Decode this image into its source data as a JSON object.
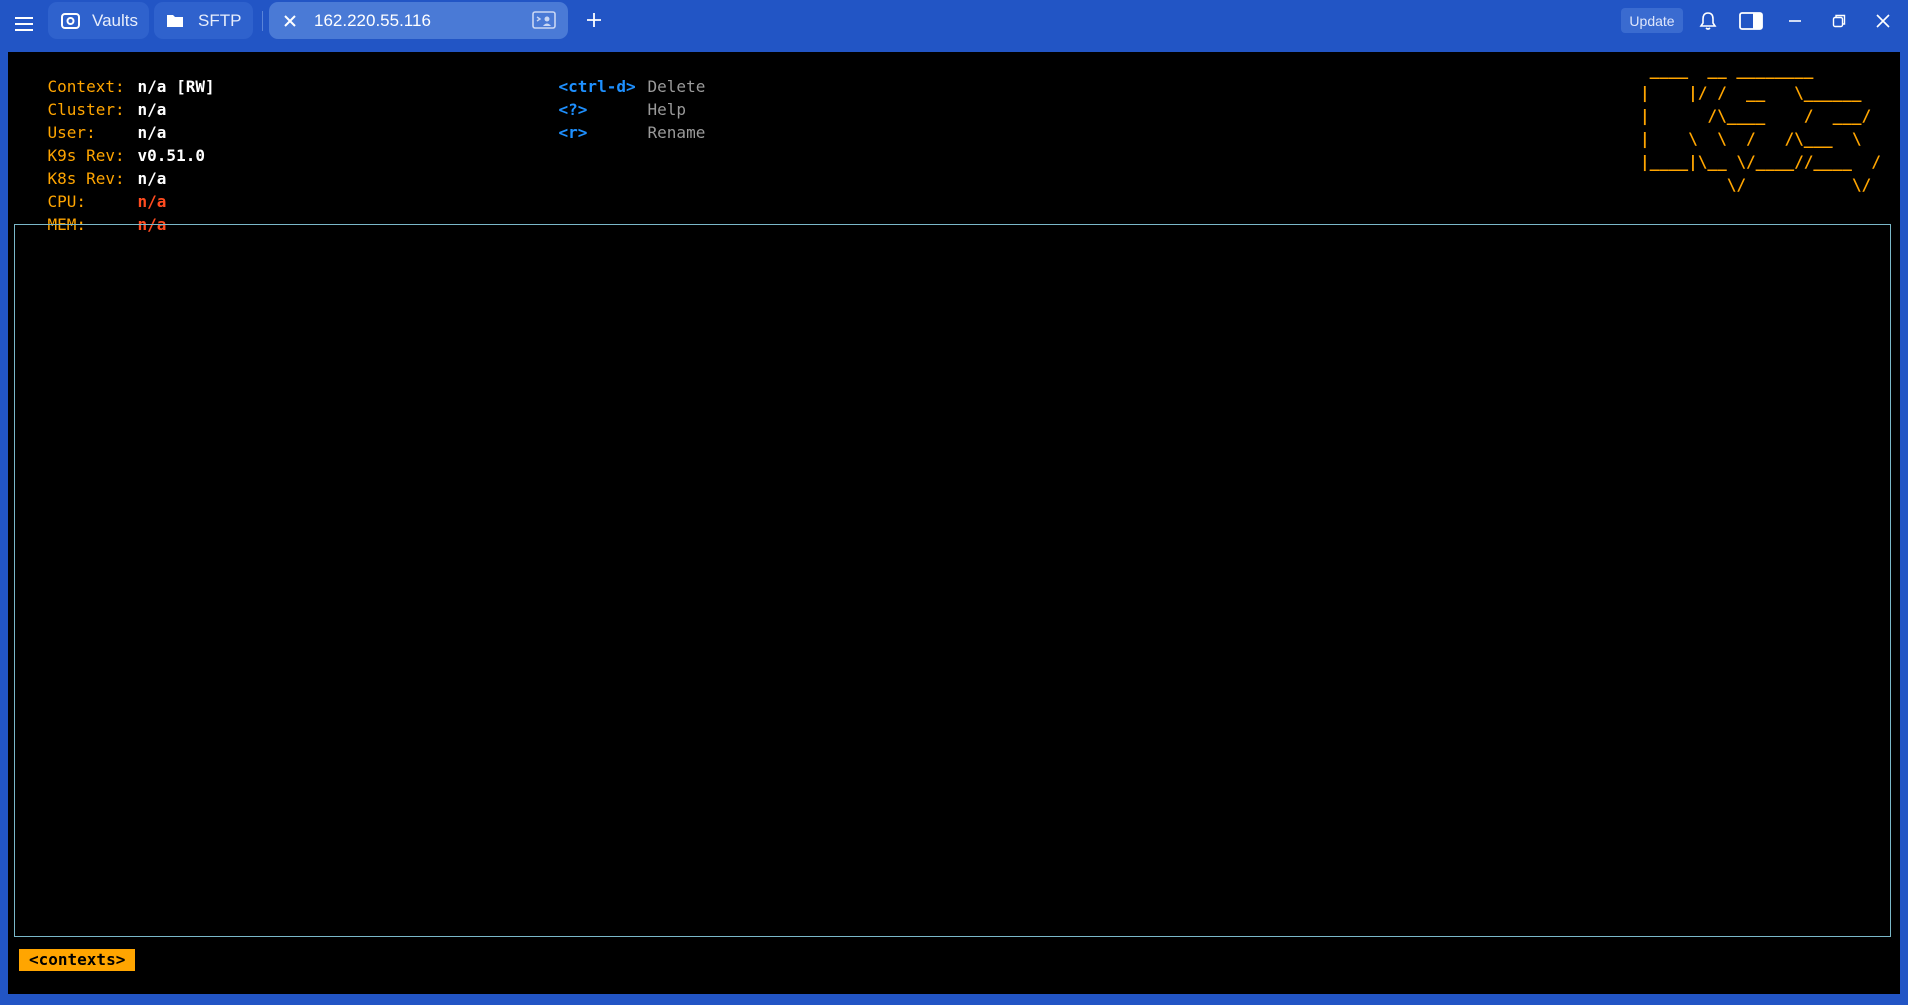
{
  "titlebar": {
    "tabs": [
      {
        "label": "Vaults",
        "icon": "vault-icon"
      },
      {
        "label": "SFTP",
        "icon": "folder-icon"
      },
      {
        "label": "162.220.55.116",
        "icon": "close-icon",
        "active": true
      }
    ],
    "update_label": "Update"
  },
  "header": {
    "info": [
      {
        "key": "Context:",
        "value": "n/a [RW]"
      },
      {
        "key": "Cluster:",
        "value": "n/a"
      },
      {
        "key": "User:",
        "value": "n/a"
      },
      {
        "key": "K9s Rev:",
        "value": "v0.51.0"
      },
      {
        "key": "K8s Rev:",
        "value": "n/a"
      },
      {
        "key": "CPU:",
        "value": "n/a"
      },
      {
        "key": "MEM:",
        "value": "n/a"
      }
    ],
    "hints": [
      {
        "key": "<ctrl-d>",
        "desc": "Delete"
      },
      {
        "key": "<?>",
        "desc": "Help"
      },
      {
        "key": "<r>",
        "desc": "Rename"
      }
    ],
    "logo": " ____  __ ________       \n|    |/ /  __   \\______ \n|      /\\____    /  ___/\n|    \\  \\  /   /\\___  \\\n|____|\\__ \\/____//____  /\n         \\/           \\/ "
  },
  "breadcrumb": "<contexts>",
  "colors": {
    "titlebar": "#2255c5",
    "terminal_bg": "#000000",
    "label_orange": "#ffa500",
    "hint_blue": "#1e90ff",
    "value_red": "#ff4b1f",
    "border_cyan": "#7ab8c9"
  }
}
